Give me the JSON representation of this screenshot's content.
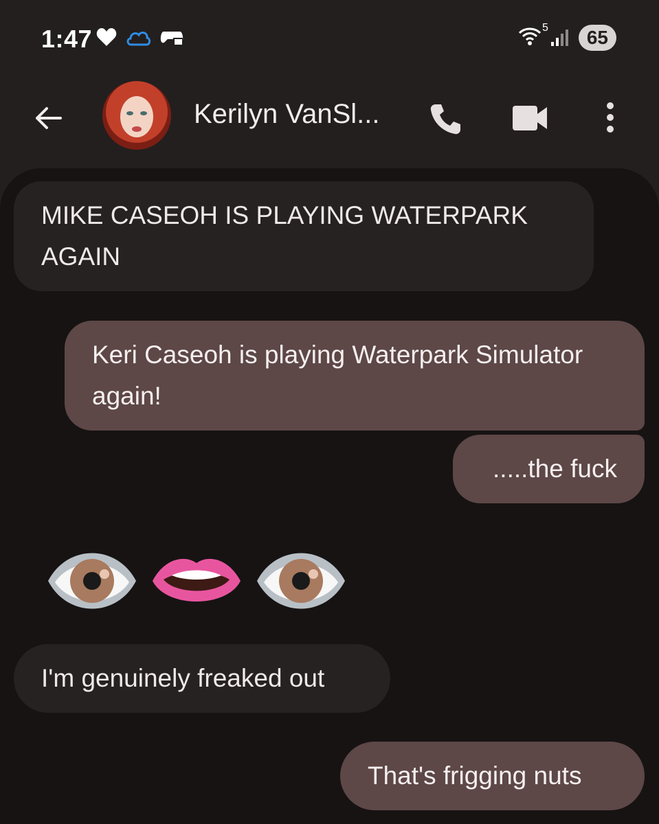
{
  "status_bar": {
    "time": "1:47",
    "battery": "65",
    "wifi_label": "5",
    "icons": [
      "heart-icon",
      "cloud-icon",
      "game-controller-icon",
      "wifi-icon",
      "signal-icon"
    ]
  },
  "header": {
    "contact_name": "Kerilyn VanSl...",
    "icons": [
      "back-arrow-icon",
      "phone-icon",
      "video-call-icon",
      "more-vert-icon"
    ]
  },
  "messages": [
    {
      "direction": "incoming",
      "text": "MIKE CASEOH IS PLAYING WATERPARK AGAIN"
    },
    {
      "direction": "outgoing",
      "text": "Keri Caseoh is playing Waterpark Simulator again!"
    },
    {
      "direction": "outgoing",
      "text": ".....the fuck"
    },
    {
      "direction": "incoming",
      "emoji": [
        "eye",
        "mouth",
        "eye"
      ]
    },
    {
      "direction": "incoming",
      "text": "I'm genuinely freaked out"
    },
    {
      "direction": "outgoing",
      "text": "That's frigging nuts"
    }
  ],
  "colors": {
    "background": "#231f1f",
    "thread_background": "#171313",
    "incoming_bubble": "#262222",
    "outgoing_bubble": "#5d4747"
  }
}
